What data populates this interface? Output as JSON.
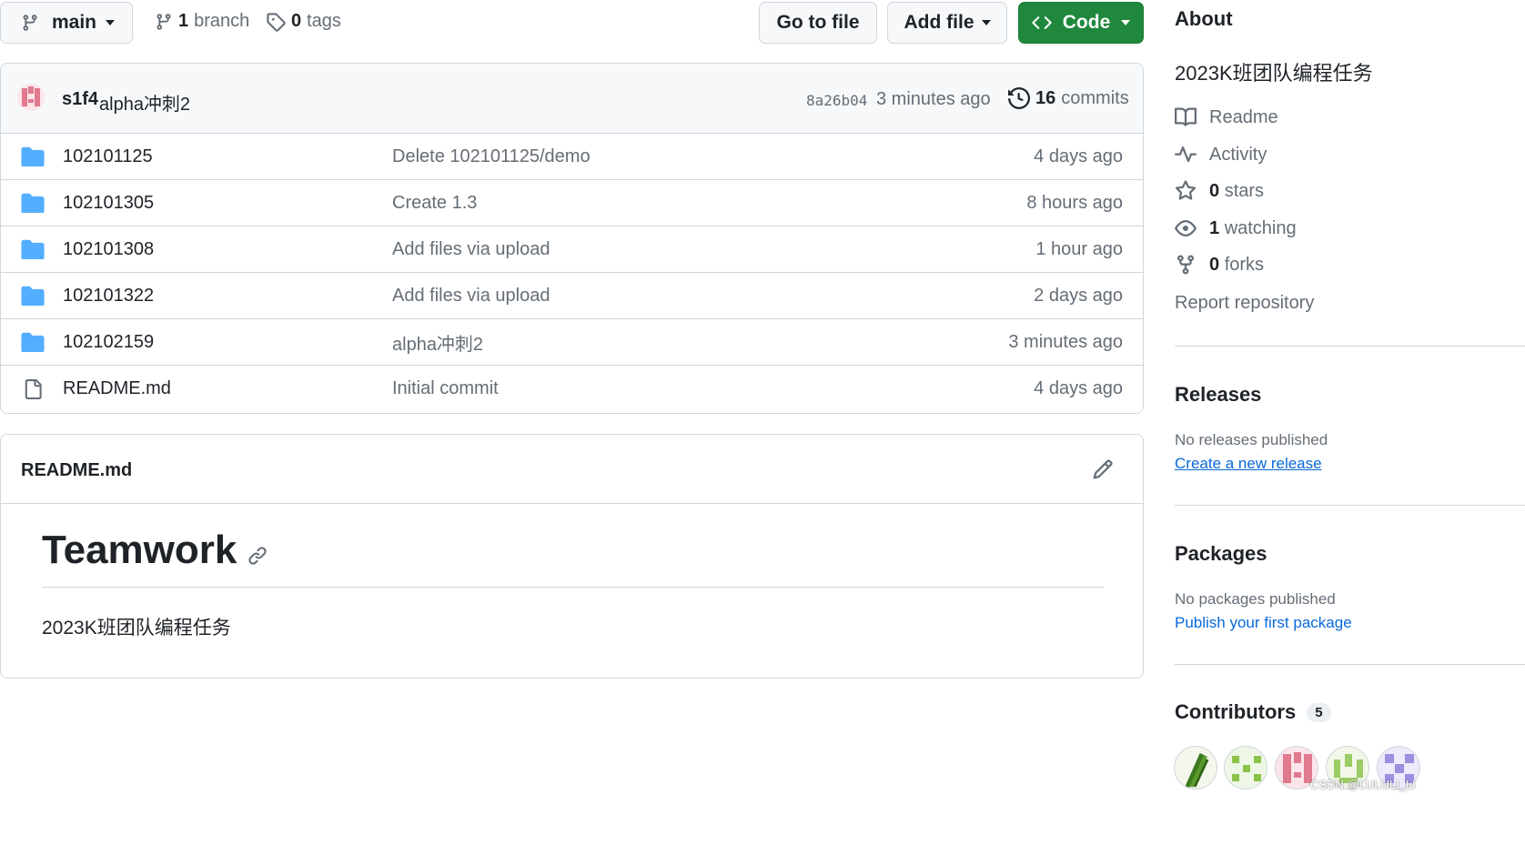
{
  "topbar": {
    "branch_name": "main",
    "branch_count": "1",
    "branch_label": "branch",
    "tag_count": "0",
    "tag_label": "tags",
    "go_to_file": "Go to file",
    "add_file": "Add file",
    "code": "Code"
  },
  "commit": {
    "author": "s1f4",
    "message": "alpha冲刺2",
    "hash": "8a26b04",
    "time": "3 minutes ago",
    "commits_count": "16",
    "commits_label": "commits"
  },
  "files": [
    {
      "name": "102101125",
      "type": "folder",
      "message": "Delete 102101125/demo",
      "age": "4 days ago"
    },
    {
      "name": "102101305",
      "type": "folder",
      "message": "Create 1.3",
      "age": "8 hours ago"
    },
    {
      "name": "102101308",
      "type": "folder",
      "message": "Add files via upload",
      "age": "1 hour ago"
    },
    {
      "name": "102101322",
      "type": "folder",
      "message": "Add files via upload",
      "age": "2 days ago"
    },
    {
      "name": "102102159",
      "type": "folder",
      "message": "alpha冲刺2",
      "age": "3 minutes ago"
    },
    {
      "name": "README.md",
      "type": "file",
      "message": "Initial commit",
      "age": "4 days ago"
    }
  ],
  "readme": {
    "filename": "README.md",
    "heading": "Teamwork",
    "body": "2023K班团队编程任务"
  },
  "about": {
    "title": "About",
    "description": "2023K班团队编程任务",
    "readme": "Readme",
    "activity": "Activity",
    "stars_count": "0",
    "stars_label": "stars",
    "watching_count": "1",
    "watching_label": "watching",
    "forks_count": "0",
    "forks_label": "forks",
    "report": "Report repository"
  },
  "releases": {
    "title": "Releases",
    "none": "No releases published",
    "link": "Create a new release"
  },
  "packages": {
    "title": "Packages",
    "none": "No packages published",
    "link": "Publish your first package"
  },
  "contributors": {
    "title": "Contributors",
    "count": "5"
  },
  "watermark": "CSDN @LULULI_LI",
  "colors": {
    "accent_green": "#1f883d",
    "link_blue": "#0969da",
    "folder_blue": "#54aeff",
    "border": "#d0d7de"
  }
}
